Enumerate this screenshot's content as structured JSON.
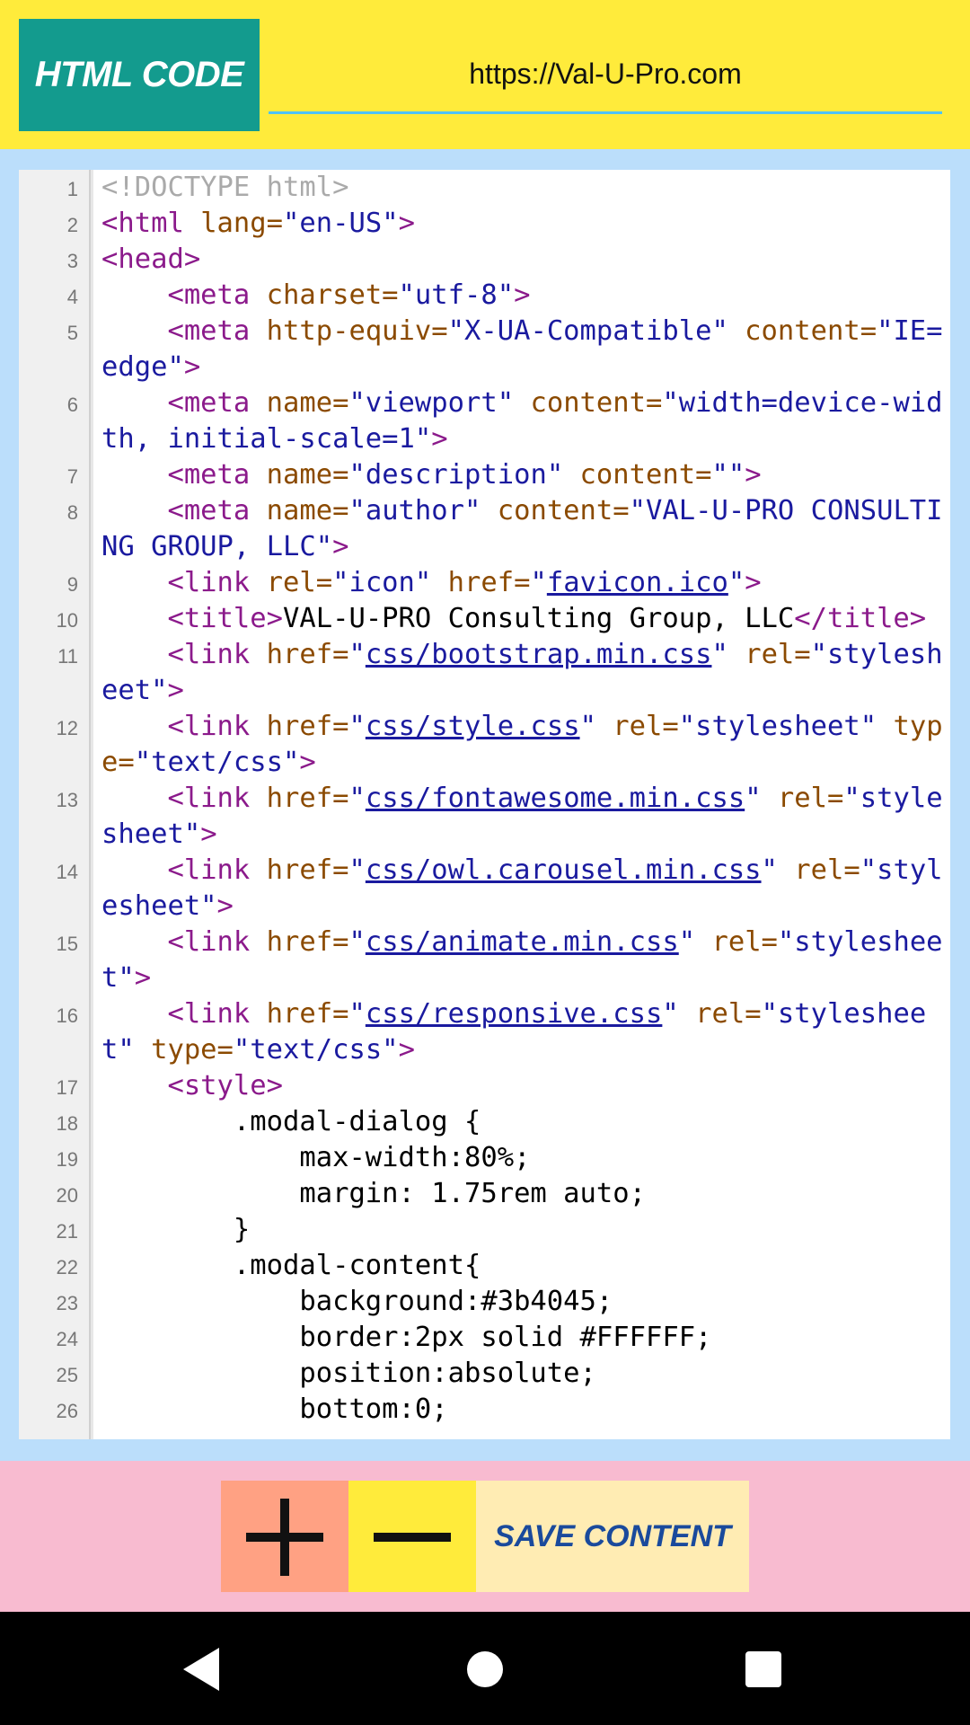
{
  "header": {
    "title": "HTML CODE",
    "url_value": "https://Val-U-Pro.com"
  },
  "code_lines": [
    {
      "n": "1",
      "tokens": [
        {
          "t": "<!DOCTYPE html>",
          "c": "comment"
        }
      ]
    },
    {
      "n": "2",
      "tokens": [
        {
          "t": "<html ",
          "c": "tag"
        },
        {
          "t": "lang=",
          "c": "attr"
        },
        {
          "t": "\"en-US\"",
          "c": "val"
        },
        {
          "t": ">",
          "c": "tag"
        }
      ]
    },
    {
      "n": "3",
      "tokens": [
        {
          "t": "<head>",
          "c": "tag"
        }
      ]
    },
    {
      "n": "4",
      "tokens": [
        {
          "t": "    <meta ",
          "c": "tag"
        },
        {
          "t": "charset=",
          "c": "attr"
        },
        {
          "t": "\"utf-8\"",
          "c": "val"
        },
        {
          "t": ">",
          "c": "tag"
        }
      ]
    },
    {
      "n": "5",
      "tokens": [
        {
          "t": "    <meta ",
          "c": "tag"
        },
        {
          "t": "http-equiv=",
          "c": "attr"
        },
        {
          "t": "\"X-UA-Compatible\" ",
          "c": "val"
        },
        {
          "t": "content=",
          "c": "attr"
        },
        {
          "t": "\"IE=edge\"",
          "c": "val"
        },
        {
          "t": ">",
          "c": "tag"
        }
      ]
    },
    {
      "n": "6",
      "tokens": [
        {
          "t": "    <meta ",
          "c": "tag"
        },
        {
          "t": "name=",
          "c": "attr"
        },
        {
          "t": "\"viewport\" ",
          "c": "val"
        },
        {
          "t": "content=",
          "c": "attr"
        },
        {
          "t": "\"width=device-width, initial-scale=1\"",
          "c": "val"
        },
        {
          "t": ">",
          "c": "tag"
        }
      ]
    },
    {
      "n": "7",
      "tokens": [
        {
          "t": "    <meta ",
          "c": "tag"
        },
        {
          "t": "name=",
          "c": "attr"
        },
        {
          "t": "\"description\" ",
          "c": "val"
        },
        {
          "t": "content=",
          "c": "attr"
        },
        {
          "t": "\"\"",
          "c": "val"
        },
        {
          "t": ">",
          "c": "tag"
        }
      ]
    },
    {
      "n": "8",
      "tokens": [
        {
          "t": "    <meta ",
          "c": "tag"
        },
        {
          "t": "name=",
          "c": "attr"
        },
        {
          "t": "\"author\" ",
          "c": "val"
        },
        {
          "t": "content=",
          "c": "attr"
        },
        {
          "t": "\"VAL-U-PRO CONSULTING GROUP, LLC\"",
          "c": "val"
        },
        {
          "t": ">",
          "c": "tag"
        }
      ]
    },
    {
      "n": "9",
      "tokens": [
        {
          "t": "    <link ",
          "c": "tag"
        },
        {
          "t": "rel=",
          "c": "attr"
        },
        {
          "t": "\"icon\" ",
          "c": "val"
        },
        {
          "t": "href=",
          "c": "attr"
        },
        {
          "t": "\"",
          "c": "val"
        },
        {
          "t": "favicon.ico",
          "c": "link"
        },
        {
          "t": "\"",
          "c": "val"
        },
        {
          "t": ">",
          "c": "tag"
        }
      ]
    },
    {
      "n": "10",
      "tokens": [
        {
          "t": "    <title>",
          "c": "tag"
        },
        {
          "t": "VAL-U-PRO Consulting Group, LLC",
          "c": "plain"
        },
        {
          "t": "</title>",
          "c": "tag"
        }
      ]
    },
    {
      "n": "11",
      "tokens": [
        {
          "t": "    <link ",
          "c": "tag"
        },
        {
          "t": "href=",
          "c": "attr"
        },
        {
          "t": "\"",
          "c": "val"
        },
        {
          "t": "css/bootstrap.min.css",
          "c": "link"
        },
        {
          "t": "\" ",
          "c": "val"
        },
        {
          "t": "rel=",
          "c": "attr"
        },
        {
          "t": "\"stylesheet\"",
          "c": "val"
        },
        {
          "t": ">",
          "c": "tag"
        }
      ]
    },
    {
      "n": "12",
      "tokens": [
        {
          "t": "    <link ",
          "c": "tag"
        },
        {
          "t": "href=",
          "c": "attr"
        },
        {
          "t": "\"",
          "c": "val"
        },
        {
          "t": "css/style.css",
          "c": "link"
        },
        {
          "t": "\" ",
          "c": "val"
        },
        {
          "t": "rel=",
          "c": "attr"
        },
        {
          "t": "\"stylesheet\" ",
          "c": "val"
        },
        {
          "t": "type=",
          "c": "attr"
        },
        {
          "t": "\"text/css\"",
          "c": "val"
        },
        {
          "t": ">",
          "c": "tag"
        }
      ]
    },
    {
      "n": "13",
      "tokens": [
        {
          "t": "    <link ",
          "c": "tag"
        },
        {
          "t": "href=",
          "c": "attr"
        },
        {
          "t": "\"",
          "c": "val"
        },
        {
          "t": "css/fontawesome.min.css",
          "c": "link"
        },
        {
          "t": "\" ",
          "c": "val"
        },
        {
          "t": "rel=",
          "c": "attr"
        },
        {
          "t": "\"stylesheet\"",
          "c": "val"
        },
        {
          "t": ">",
          "c": "tag"
        }
      ]
    },
    {
      "n": "14",
      "tokens": [
        {
          "t": "    <link ",
          "c": "tag"
        },
        {
          "t": "href=",
          "c": "attr"
        },
        {
          "t": "\"",
          "c": "val"
        },
        {
          "t": "css/owl.carousel.min.css",
          "c": "link"
        },
        {
          "t": "\" ",
          "c": "val"
        },
        {
          "t": "rel=",
          "c": "attr"
        },
        {
          "t": "\"stylesheet\"",
          "c": "val"
        },
        {
          "t": ">",
          "c": "tag"
        }
      ]
    },
    {
      "n": "15",
      "tokens": [
        {
          "t": "    <link ",
          "c": "tag"
        },
        {
          "t": "href=",
          "c": "attr"
        },
        {
          "t": "\"",
          "c": "val"
        },
        {
          "t": "css/animate.min.css",
          "c": "link"
        },
        {
          "t": "\" ",
          "c": "val"
        },
        {
          "t": "rel=",
          "c": "attr"
        },
        {
          "t": "\"stylesheet\"",
          "c": "val"
        },
        {
          "t": ">",
          "c": "tag"
        }
      ]
    },
    {
      "n": "16",
      "tokens": [
        {
          "t": "    <link ",
          "c": "tag"
        },
        {
          "t": "href=",
          "c": "attr"
        },
        {
          "t": "\"",
          "c": "val"
        },
        {
          "t": "css/responsive.css",
          "c": "link"
        },
        {
          "t": "\" ",
          "c": "val"
        },
        {
          "t": "rel=",
          "c": "attr"
        },
        {
          "t": "\"stylesheet\" ",
          "c": "val"
        },
        {
          "t": "type=",
          "c": "attr"
        },
        {
          "t": "\"text/css\"",
          "c": "val"
        },
        {
          "t": ">",
          "c": "tag"
        }
      ]
    },
    {
      "n": "17",
      "tokens": [
        {
          "t": "    <style>",
          "c": "tag"
        }
      ]
    },
    {
      "n": "18",
      "tokens": [
        {
          "t": "        .modal-dialog {",
          "c": "plain"
        }
      ]
    },
    {
      "n": "19",
      "tokens": [
        {
          "t": "            max-width:80%;",
          "c": "plain"
        }
      ]
    },
    {
      "n": "20",
      "tokens": [
        {
          "t": "            margin: 1.75rem auto;",
          "c": "plain"
        }
      ]
    },
    {
      "n": "21",
      "tokens": [
        {
          "t": "        }",
          "c": "plain"
        }
      ]
    },
    {
      "n": "22",
      "tokens": [
        {
          "t": "        .modal-content{",
          "c": "plain"
        }
      ]
    },
    {
      "n": "23",
      "tokens": [
        {
          "t": "            background:#3b4045;",
          "c": "plain"
        }
      ]
    },
    {
      "n": "24",
      "tokens": [
        {
          "t": "            border:2px solid #FFFFFF;",
          "c": "plain"
        }
      ]
    },
    {
      "n": "25",
      "tokens": [
        {
          "t": "            position:absolute;",
          "c": "plain"
        }
      ]
    },
    {
      "n": "26",
      "tokens": [
        {
          "t": "            bottom:0;",
          "c": "plain"
        }
      ]
    }
  ],
  "toolbar": {
    "plus_icon": "plus-icon",
    "minus_icon": "minus-icon",
    "save_label": "SAVE CONTENT"
  },
  "navbar": {
    "back_icon": "back-triangle-icon",
    "home_icon": "home-circle-icon",
    "recent_icon": "recent-square-icon"
  },
  "colors": {
    "header_bg": "#FFEB3B",
    "title_bg": "#139B8E",
    "code_panel_bg": "#BBDEFB",
    "toolbar_bg": "#F8BBD0",
    "plus_bg": "#FFA183",
    "minus_bg": "#FFEB3B",
    "save_bg": "#FFECB3",
    "save_text": "#1A4A9C"
  }
}
